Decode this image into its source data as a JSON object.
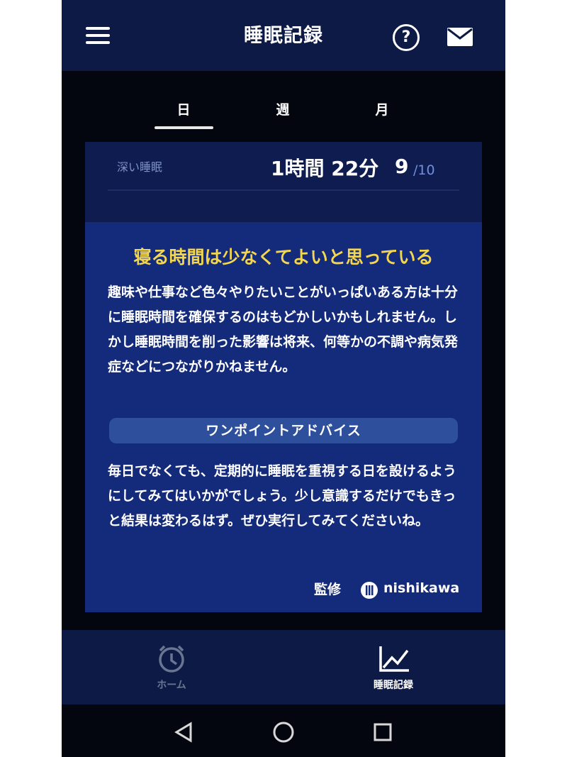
{
  "app_bar": {
    "title": "睡眠記録",
    "icons": [
      "menu-icon",
      "help-icon",
      "mail-icon"
    ],
    "help_glyph": "?"
  },
  "tabs": [
    {
      "label": "日",
      "selected": true
    },
    {
      "label": "週",
      "selected": false
    },
    {
      "label": "月",
      "selected": false
    }
  ],
  "stat": {
    "label": "深い睡眠",
    "duration": "1時間 22分",
    "score": "9",
    "score_max": "/10"
  },
  "advice": {
    "title": "寝る時間は少なくてよいと思っている",
    "body": "趣味や仕事など色々やりたいことがいっぱいある方は十分に睡眠時間を確保するのはもどかしいかもしれません。しかし睡眠時間を削った影響は将来、何等かの不調や病気発症などにつながりかねません。",
    "onepoint_label": "ワンポイントアドバイス",
    "tip": "毎日でなくても、定期的に睡眠を重視する日を設けるようにしてみてはいかがでしょう。少し意識するだけでもきっと結果は変わるはず。ぜひ実行してみてくださいね。",
    "supervisor_label": "監修",
    "brand": "nishikawa"
  },
  "bottom_nav": [
    {
      "label": "ホーム",
      "icon": "alarm-clock-icon",
      "active": false
    },
    {
      "label": "睡眠記録",
      "icon": "line-chart-icon",
      "active": true
    }
  ],
  "system_nav": [
    "back-icon",
    "home-circle-icon",
    "recents-square-icon"
  ],
  "colors": {
    "app_bar_bg": "#0d1a45",
    "panel_bg": "#142a7a",
    "title_yellow": "#f3d64e",
    "accent_blue": "#6f8ee0",
    "inactive_nav": "#6a7593"
  }
}
